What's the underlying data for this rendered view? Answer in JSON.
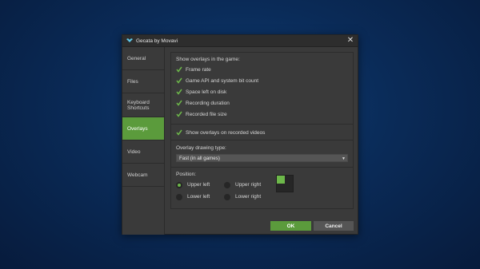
{
  "window": {
    "title": "Gecata by Movavi",
    "close_glyph": "✕"
  },
  "sidebar": {
    "items": [
      {
        "label": "General",
        "active": false
      },
      {
        "label": "Files",
        "active": false
      },
      {
        "label": "Keyboard Shortcuts",
        "active": false
      },
      {
        "label": "Overlays",
        "active": true
      },
      {
        "label": "Video",
        "active": false
      },
      {
        "label": "Webcam",
        "active": false
      }
    ]
  },
  "overlays": {
    "show_title": "Show overlays in the game:",
    "options": [
      {
        "label": "Frame rate",
        "checked": true
      },
      {
        "label": "Game API and system bit count",
        "checked": true
      },
      {
        "label": "Space left on disk",
        "checked": true
      },
      {
        "label": "Recording duration",
        "checked": true
      },
      {
        "label": "Recorded file size",
        "checked": true
      }
    ],
    "recorded": {
      "label": "Show overlays on recorded videos",
      "checked": true
    },
    "drawing_type_title": "Overlay drawing type:",
    "drawing_type_value": "Fast (in all games)",
    "position_title": "Position:",
    "positions": [
      {
        "label": "Upper left",
        "selected": true
      },
      {
        "label": "Upper right",
        "selected": false
      },
      {
        "label": "Lower left",
        "selected": false
      },
      {
        "label": "Lower right",
        "selected": false
      }
    ]
  },
  "buttons": {
    "ok": "OK",
    "cancel": "Cancel"
  },
  "colors": {
    "accent": "#5b9b3c",
    "check": "#6db84a",
    "background": "#3a3a3a"
  },
  "icons": {
    "app": "gecata-logo-icon",
    "dropdown": "chevron-down-icon"
  }
}
